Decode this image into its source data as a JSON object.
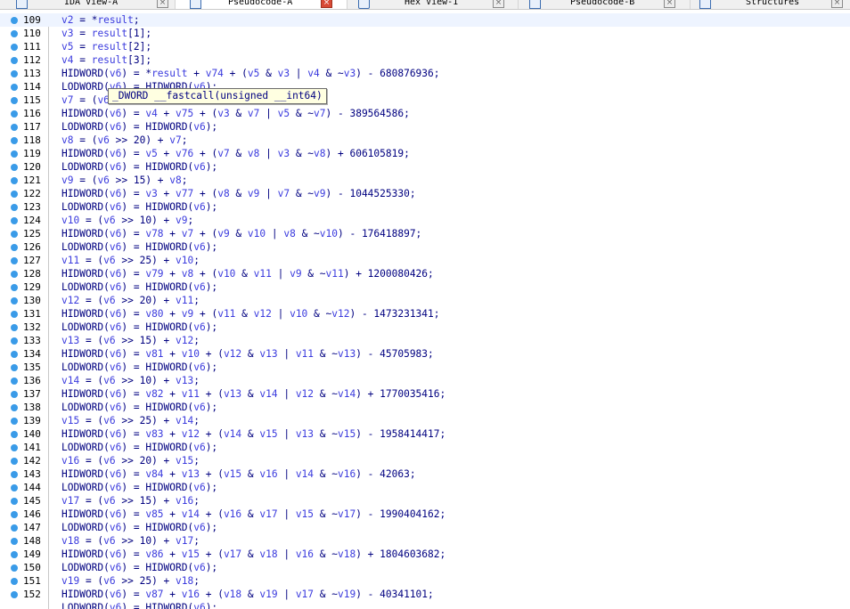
{
  "tabs": [
    {
      "label": "IDA View-A",
      "active": false
    },
    {
      "label": "Pseudocode-A",
      "active": true
    },
    {
      "label": "Hex View-1",
      "active": false
    },
    {
      "label": "Pseudocode-B",
      "active": false
    },
    {
      "label": "Structures",
      "active": false
    }
  ],
  "tooltip": "_DWORD __fastcall(unsigned __int64)",
  "lines": [
    {
      "n": "109",
      "code": "v2 = *result;"
    },
    {
      "n": "110",
      "code": "v3 = result[1];"
    },
    {
      "n": "111",
      "code": "v5 = result[2];"
    },
    {
      "n": "112",
      "code": "v4 = result[3];"
    },
    {
      "n": "113",
      "code": "HIDWORD(v6) = *result + v74 + (v5 & v3 | v4 & ~v3) - 680876936;"
    },
    {
      "n": "114",
      "code": "LODWORD(v6) = HIDWORD(v6);"
    },
    {
      "n": "115",
      "code": "v7 = (v6 >> 25) + v5;"
    },
    {
      "n": "116",
      "code": "HIDWORD(v6) = v4 + v75 + (v3 & v7 | v5 & ~v7) - 389564586;"
    },
    {
      "n": "117",
      "code": "LODWORD(v6) = HIDWORD(v6);"
    },
    {
      "n": "118",
      "code": "v8 = (v6 >> 20) + v7;"
    },
    {
      "n": "119",
      "code": "HIDWORD(v6) = v5 + v76 + (v7 & v8 | v3 & ~v8) + 606105819;"
    },
    {
      "n": "120",
      "code": "LODWORD(v6) = HIDWORD(v6);"
    },
    {
      "n": "121",
      "code": "v9 = (v6 >> 15) + v8;"
    },
    {
      "n": "122",
      "code": "HIDWORD(v6) = v3 + v77 + (v8 & v9 | v7 & ~v9) - 1044525330;"
    },
    {
      "n": "123",
      "code": "LODWORD(v6) = HIDWORD(v6);"
    },
    {
      "n": "124",
      "code": "v10 = (v6 >> 10) + v9;"
    },
    {
      "n": "125",
      "code": "HIDWORD(v6) = v78 + v7 + (v9 & v10 | v8 & ~v10) - 176418897;"
    },
    {
      "n": "126",
      "code": "LODWORD(v6) = HIDWORD(v6);"
    },
    {
      "n": "127",
      "code": "v11 = (v6 >> 25) + v10;"
    },
    {
      "n": "128",
      "code": "HIDWORD(v6) = v79 + v8 + (v10 & v11 | v9 & ~v11) + 1200080426;"
    },
    {
      "n": "129",
      "code": "LODWORD(v6) = HIDWORD(v6);"
    },
    {
      "n": "130",
      "code": "v12 = (v6 >> 20) + v11;"
    },
    {
      "n": "131",
      "code": "HIDWORD(v6) = v80 + v9 + (v11 & v12 | v10 & ~v12) - 1473231341;"
    },
    {
      "n": "132",
      "code": "LODWORD(v6) = HIDWORD(v6);"
    },
    {
      "n": "133",
      "code": "v13 = (v6 >> 15) + v12;"
    },
    {
      "n": "134",
      "code": "HIDWORD(v6) = v81 + v10 + (v12 & v13 | v11 & ~v13) - 45705983;"
    },
    {
      "n": "135",
      "code": "LODWORD(v6) = HIDWORD(v6);"
    },
    {
      "n": "136",
      "code": "v14 = (v6 >> 10) + v13;"
    },
    {
      "n": "137",
      "code": "HIDWORD(v6) = v82 + v11 + (v13 & v14 | v12 & ~v14) + 1770035416;"
    },
    {
      "n": "138",
      "code": "LODWORD(v6) = HIDWORD(v6);"
    },
    {
      "n": "139",
      "code": "v15 = (v6 >> 25) + v14;"
    },
    {
      "n": "140",
      "code": "HIDWORD(v6) = v83 + v12 + (v14 & v15 | v13 & ~v15) - 1958414417;"
    },
    {
      "n": "141",
      "code": "LODWORD(v6) = HIDWORD(v6);"
    },
    {
      "n": "142",
      "code": "v16 = (v6 >> 20) + v15;"
    },
    {
      "n": "143",
      "code": "HIDWORD(v6) = v84 + v13 + (v15 & v16 | v14 & ~v16) - 42063;"
    },
    {
      "n": "144",
      "code": "LODWORD(v6) = HIDWORD(v6);"
    },
    {
      "n": "145",
      "code": "v17 = (v6 >> 15) + v16;"
    },
    {
      "n": "146",
      "code": "HIDWORD(v6) = v85 + v14 + (v16 & v17 | v15 & ~v17) - 1990404162;"
    },
    {
      "n": "147",
      "code": "LODWORD(v6) = HIDWORD(v6);"
    },
    {
      "n": "148",
      "code": "v18 = (v6 >> 10) + v17;"
    },
    {
      "n": "149",
      "code": "HIDWORD(v6) = v86 + v15 + (v17 & v18 | v16 & ~v18) + 1804603682;"
    },
    {
      "n": "150",
      "code": "LODWORD(v6) = HIDWORD(v6);"
    },
    {
      "n": "151",
      "code": "v19 = (v6 >> 25) + v18;"
    },
    {
      "n": "152",
      "code": "HIDWORD(v6) = v87 + v16 + (v18 & v19 | v17 & ~v19) - 40341101;"
    },
    {
      "n": "",
      "code": "LODWORD(v6) = HIDWORD(v6);"
    }
  ]
}
